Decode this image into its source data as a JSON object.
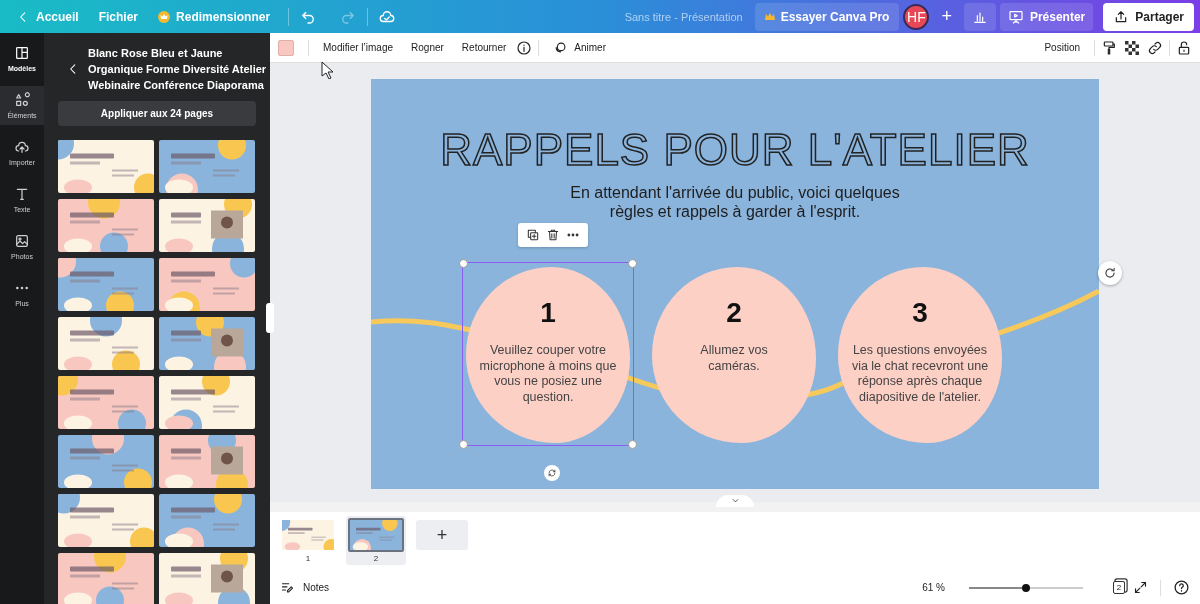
{
  "topbar": {
    "home": "Accueil",
    "file": "Fichier",
    "resize": "Redimensionner",
    "redo_disabled": true,
    "doc_title": "Sans titre - Présentation",
    "pro": "Essayer Canva Pro",
    "avatar": "HF",
    "add": "+",
    "present": "Présenter",
    "share": "Partager"
  },
  "rail": [
    {
      "label": "Modèles",
      "selected": true
    },
    {
      "label": "Éléments",
      "selected": false
    },
    {
      "label": "Importer",
      "selected": false
    },
    {
      "label": "Texte",
      "selected": false
    },
    {
      "label": "Photos",
      "selected": false
    },
    {
      "label": "Plus",
      "selected": false
    }
  ],
  "panel": {
    "title_lines": [
      "Blanc Rose Bleu et Jaune",
      "Organique Forme Diversité Atelier",
      "Webinaire Conférence Diaporama"
    ],
    "apply": "Appliquer aux 24 pages",
    "templates": [
      {
        "kind": "picture"
      },
      {
        "kind": "picture"
      },
      {
        "kind": "picture"
      },
      {
        "kind": "picture"
      },
      {
        "kind": "picture"
      },
      {
        "kind": "picture"
      },
      {
        "kind": "picture"
      },
      {
        "kind": "picture"
      },
      {
        "kind": "picture"
      },
      {
        "kind": "picture"
      },
      {
        "kind": "picture"
      },
      {
        "kind": "picture"
      },
      {
        "kind": "picture"
      },
      {
        "kind": "picture"
      },
      {
        "kind": "picture"
      },
      {
        "kind": "picture"
      }
    ]
  },
  "toolbar": {
    "edit": "Modifier l’image",
    "crop": "Rogner",
    "flip": "Retourner",
    "animate": "Animer",
    "position": "Position"
  },
  "slide": {
    "title": "RAPPELS POUR L'ATELIER",
    "subtitle_lines": [
      "En attendant l'arrivée du public, voici quelques",
      "règles et rappels à garder à l'esprit."
    ],
    "circles": [
      {
        "number": "1",
        "lines": [
          "Veuillez couper votre",
          "microphone à moins que",
          "vous ne posiez une",
          "question."
        ],
        "selected": true
      },
      {
        "number": "2",
        "lines": [
          "Allumez vos",
          "caméras."
        ],
        "selected": false
      },
      {
        "number": "3",
        "lines": [
          "Les questions envoyées",
          "via le chat recevront une",
          "réponse après chaque",
          "diapositive de l'atelier."
        ],
        "selected": false
      }
    ]
  },
  "pages": [
    {
      "number": "1",
      "kind": "picture",
      "selected": false
    },
    {
      "number": "2",
      "kind": "picture",
      "selected": true
    }
  ],
  "add_page": "+",
  "footer": {
    "notes": "Notes",
    "zoom": "61 %",
    "zoom_slider": {
      "level": 0.5
    },
    "page_count": "2"
  }
}
